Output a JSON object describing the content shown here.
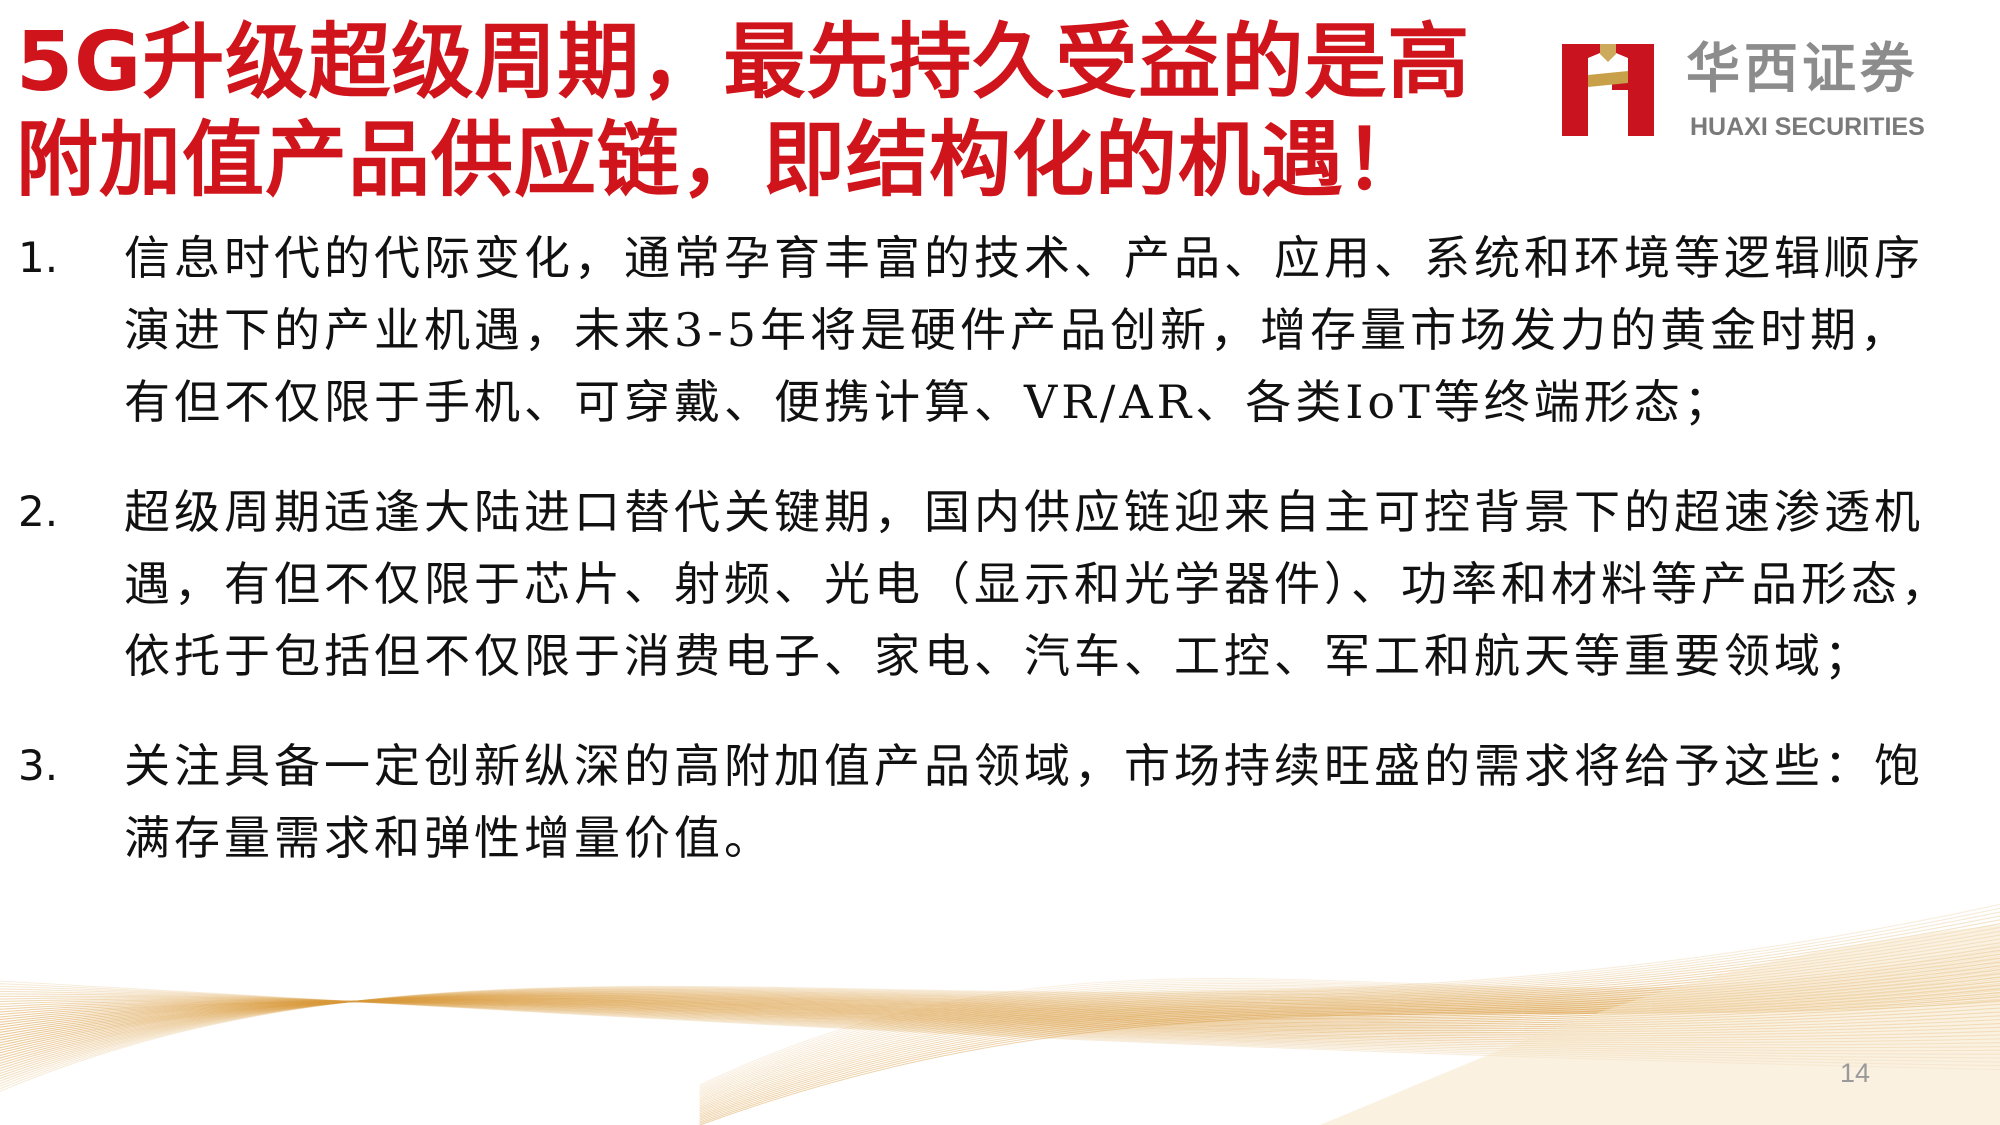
{
  "title": {
    "line1": "5G升级超级周期，最先持久受益的是高",
    "line2": "附加值产品供应链，即结构化的机遇！"
  },
  "logo": {
    "icon": "huaxi-h-logo-icon",
    "name_cn": "华西证券",
    "name_en": "HUAXI SECURITIES",
    "colors": {
      "red": "#c9141f",
      "gold": "#c8a04a"
    }
  },
  "points": [
    {
      "number": "1.",
      "text": "信息时代的代际变化，通常孕育丰富的技术、产品、应用、系统和环境等逻辑顺序演进下的产业机遇，未来3-5年将是硬件产品创新，增存量市场发力的黄金时期，有但不仅限于手机、可穿戴、便携计算、VR/AR、各类IoT等终端形态；"
    },
    {
      "number": "2.",
      "text": "超级周期适逢大陆进口替代关键期，国内供应链迎来自主可控背景下的超速渗透机遇，有但不仅限于芯片、射频、光电（显示和光学器件）、功率和材料等产品形态，依托于包括但不仅限于消费电子、家电、汽车、工控、军工和航天等重要领域；"
    },
    {
      "number": "3.",
      "text": "关注具备一定创新纵深的高附加值产品领域，市场持续旺盛的需求将给予这些：饱满存量需求和弹性增量价值。"
    }
  ],
  "page_number": "14",
  "decoration": {
    "wave_icon": "gold-wave-lines-icon",
    "colors": {
      "title_red": "#d0141b",
      "wave_gold": "#d99a3c"
    }
  }
}
